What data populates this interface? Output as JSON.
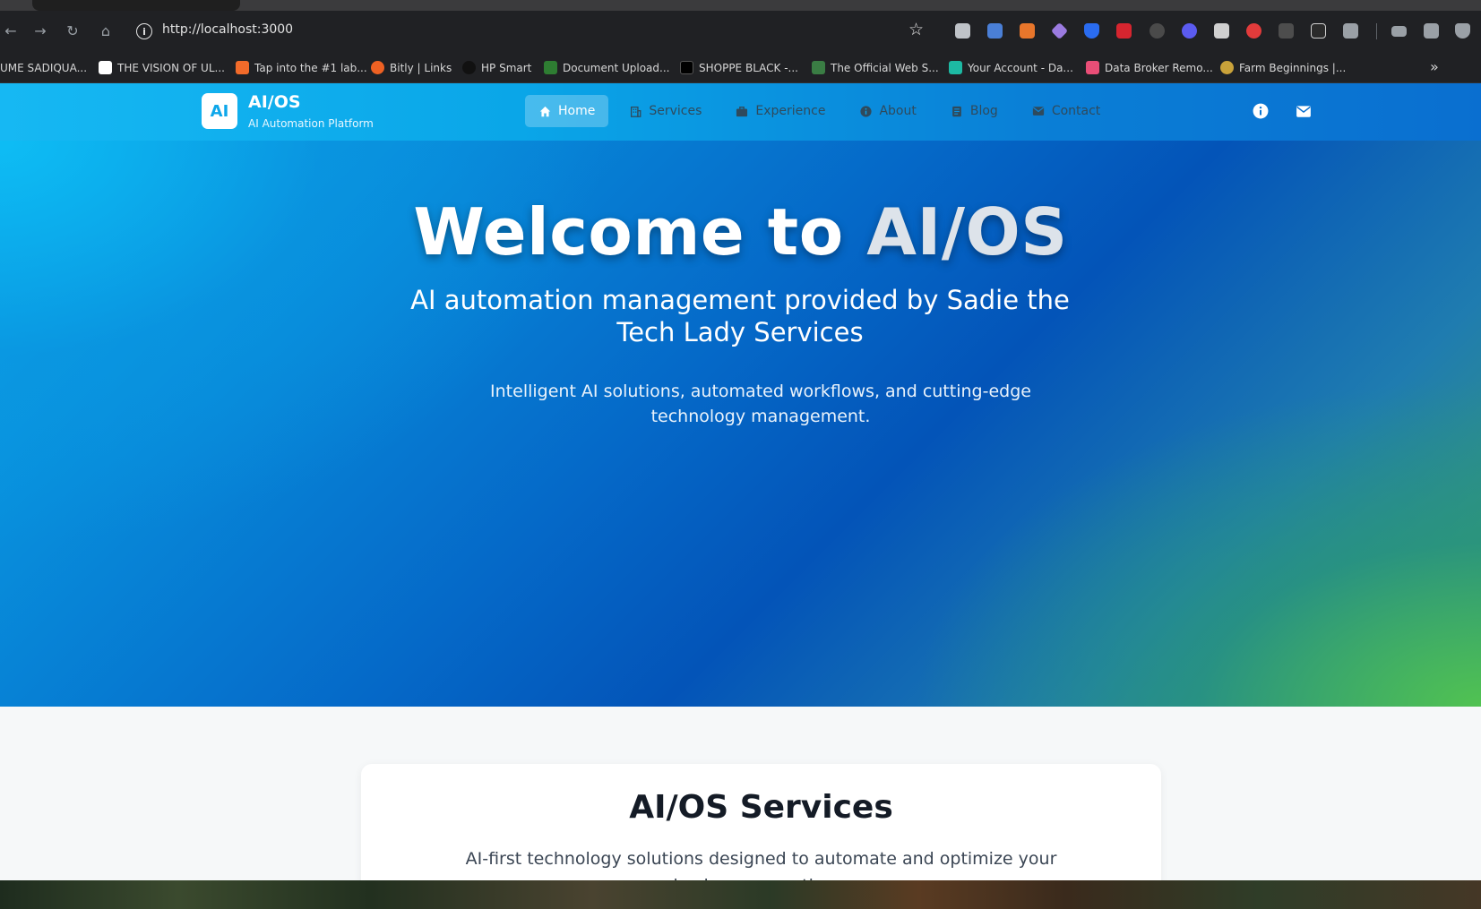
{
  "browser": {
    "url": "http://localhost:3000",
    "bookmarks": [
      {
        "label": "UME SADIQUA...",
        "color": "#202124"
      },
      {
        "label": "THE VISION OF UL...",
        "color": "#ffffff"
      },
      {
        "label": "Tap into the #1 lab...",
        "color": "#f26b2a"
      },
      {
        "label": "Bitly | Links",
        "color": "#ee6123"
      },
      {
        "label": "HP Smart",
        "color": "#111111"
      },
      {
        "label": "Document Upload...",
        "color": "#2e7d32"
      },
      {
        "label": "SHOPPE BLACK -...",
        "color": "#000000"
      },
      {
        "label": "The Official Web S...",
        "color": "#3a7d44"
      },
      {
        "label": "Your Account - Da...",
        "color": "#1db9a3"
      },
      {
        "label": "Data Broker Remo...",
        "color": "#e94e77"
      },
      {
        "label": "Farm Beginnings |...",
        "color": "#c9a23a"
      }
    ]
  },
  "site": {
    "logo_text": "AI",
    "brand_title": "AI/OS",
    "brand_subtitle": "AI Automation Platform",
    "nav": [
      {
        "label": "Home",
        "icon": "home-icon"
      },
      {
        "label": "Services",
        "icon": "building-icon"
      },
      {
        "label": "Experience",
        "icon": "briefcase-icon"
      },
      {
        "label": "About",
        "icon": "info-icon"
      },
      {
        "label": "Blog",
        "icon": "document-icon"
      },
      {
        "label": "Contact",
        "icon": "mail-icon"
      }
    ],
    "active_nav": "Home"
  },
  "hero": {
    "title_lead": "Welcome to ",
    "title_accent": "AI/OS",
    "subtitle": "AI automation management provided by Sadie the Tech Lady Services",
    "description": "Intelligent AI solutions, automated workflows, and cutting-edge technology management."
  },
  "services": {
    "title": "AI/OS Services",
    "description": "AI-first technology solutions designed to automate and optimize your business operations."
  },
  "colors": {
    "header_start": "#16b8f3",
    "header_end": "#0a6fd0",
    "hero_blue": "#0354b8",
    "hero_green": "#52c450"
  }
}
